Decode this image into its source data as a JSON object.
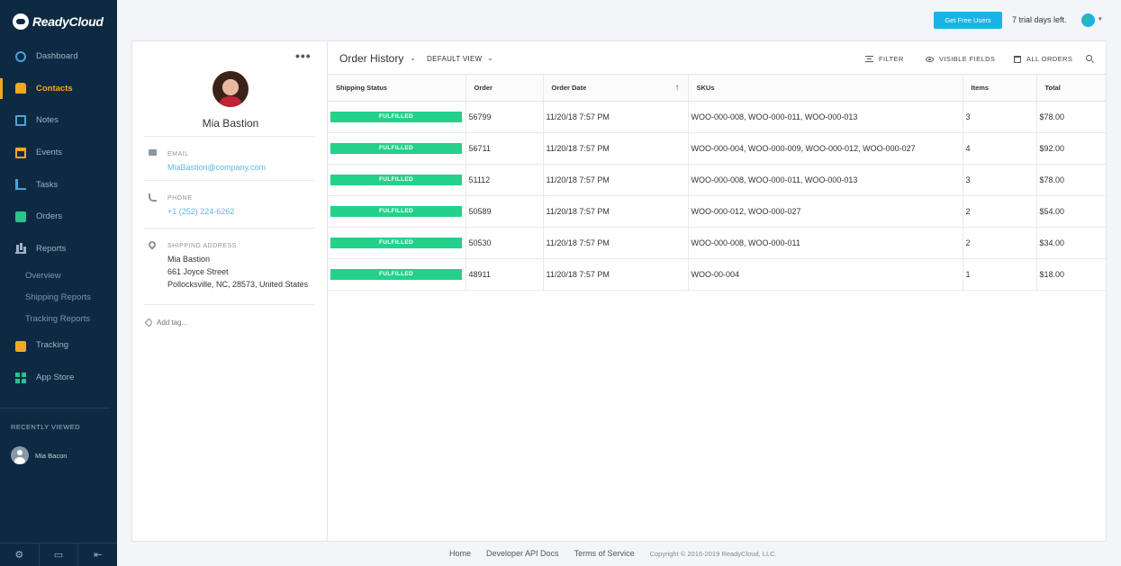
{
  "app": {
    "name": "ReadyCloud"
  },
  "sidebar": {
    "items": [
      {
        "label": "Dashboard",
        "icon": "dashboard-icon"
      },
      {
        "label": "Contacts",
        "icon": "contacts-icon",
        "active": true
      },
      {
        "label": "Notes",
        "icon": "notes-icon"
      },
      {
        "label": "Events",
        "icon": "events-icon"
      },
      {
        "label": "Tasks",
        "icon": "tasks-icon"
      },
      {
        "label": "Orders",
        "icon": "orders-icon"
      },
      {
        "label": "Reports",
        "icon": "reports-icon"
      }
    ],
    "report_subitems": [
      "Overview",
      "Shipping Reports",
      "Tracking Reports"
    ],
    "items_after": [
      {
        "label": "Tracking",
        "icon": "tracking-icon"
      },
      {
        "label": "App Store",
        "icon": "app-store-icon"
      }
    ],
    "recently_viewed_title": "RECENTLY VIEWED",
    "recent": [
      {
        "name": "Mia Bacon"
      }
    ],
    "bottom_icons": [
      "gear-icon",
      "keyboard-icon",
      "collapse-sidebar-icon"
    ]
  },
  "topbar": {
    "free_users_label": "Get Free Users",
    "trial_text": "7 trial days left.",
    "caret": "▾"
  },
  "contact": {
    "more": "•••",
    "name": "Mia Bastion",
    "email_label": "EMAIL",
    "email": "MiaBastion@company.com",
    "phone_label": "PHONE",
    "phone": "+1 (252) 224-6262",
    "address_label": "SHIPPING ADDRESS",
    "address_line1": "Mia Bastion",
    "address_line2": "661 Joyce Street",
    "address_line3": "Pollocksville, NC, 28573, United States",
    "add_tag": "Add tag..."
  },
  "orders": {
    "title": "Order History",
    "view": "DEFAULT VIEW",
    "caret": "⌄",
    "filter_label": "FILTER",
    "visible_fields_label": "VISIBLE FIELDS",
    "all_orders_label": "ALL ORDERS",
    "columns": [
      "Shipping Status",
      "Order",
      "Order Date",
      "SKUs",
      "Items",
      "Total"
    ],
    "sort_arrow": "↑",
    "rows": [
      {
        "status": "FULFILLED",
        "order": "56799",
        "date": "11/20/18 7:57 PM",
        "skus": "WOO-000-008, WOO-000-011, WOO-000-013",
        "items": "3",
        "total": "$78.00"
      },
      {
        "status": "FULFILLED",
        "order": "56711",
        "date": "11/20/18 7:57 PM",
        "skus": "WOO-000-004, WOO-000-009, WOO-000-012, WOO-000-027",
        "items": "4",
        "total": "$92.00"
      },
      {
        "status": "FULFILLED",
        "order": "51112",
        "date": "11/20/18 7:57 PM",
        "skus": "WOO-000-008, WOO-000-011, WOO-000-013",
        "items": "3",
        "total": "$78.00"
      },
      {
        "status": "FULFILLED",
        "order": "50589",
        "date": "11/20/18 7:57 PM",
        "skus": "WOO-000-012, WOO-000-027",
        "items": "2",
        "total": "$54.00"
      },
      {
        "status": "FULFILLED",
        "order": "50530",
        "date": "11/20/18 7:57 PM",
        "skus": "WOO-000-008, WOO-000-011",
        "items": "2",
        "total": "$34.00"
      },
      {
        "status": "FULFILLED",
        "order": "48911",
        "date": "11/20/18 7:57 PM",
        "skus": "WOO-00-004",
        "items": "1",
        "total": "$18.00"
      }
    ]
  },
  "footer": {
    "links": [
      "Home",
      "Developer API Docs",
      "Terms of Service"
    ],
    "copyright": "Copyright © 2016-2019 ReadyCloud, LLC."
  },
  "colors": {
    "sidebar_bg": "#0e2a42",
    "active": "#f5a623",
    "accent_blue": "#1ab3e8",
    "fulfilled_green": "#23d18b",
    "link_blue": "#5bb8e3"
  }
}
